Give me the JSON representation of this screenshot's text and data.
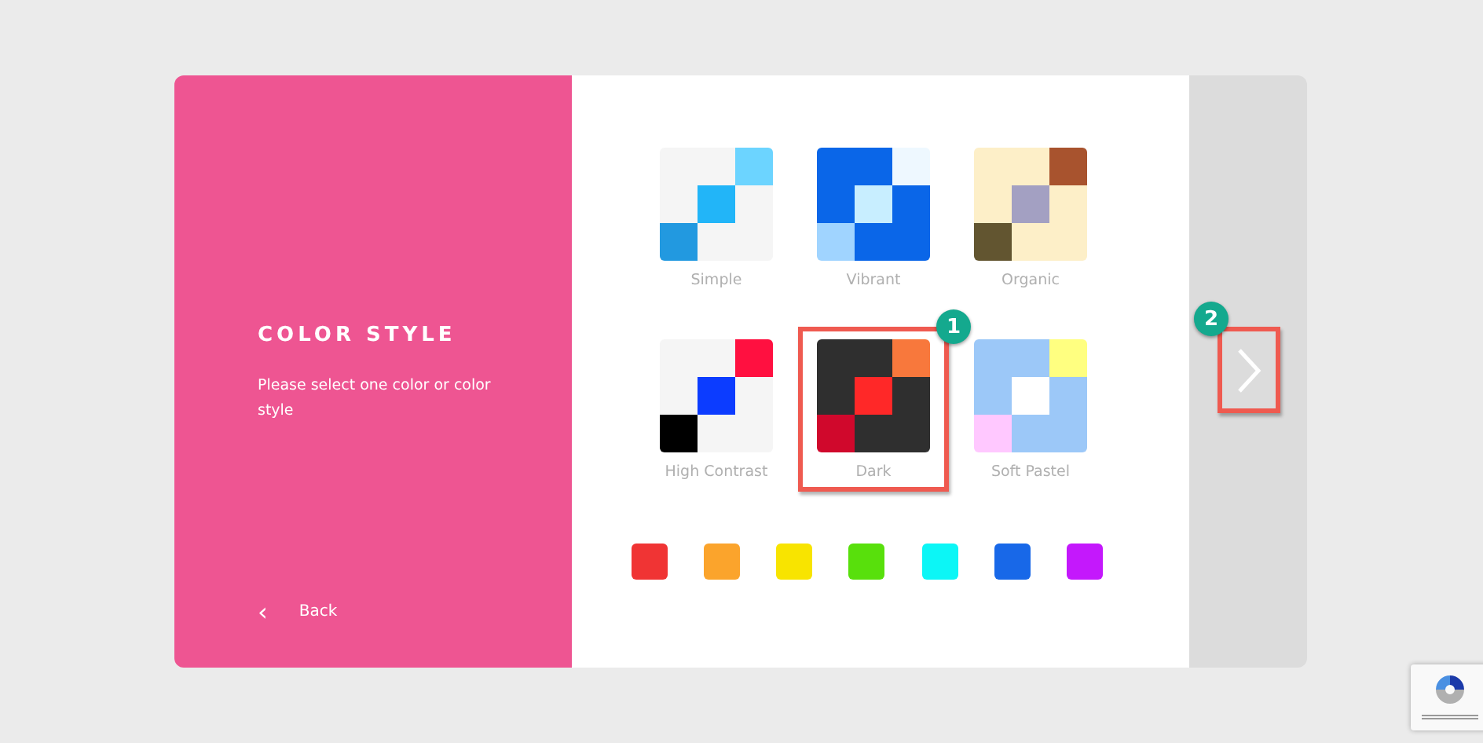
{
  "intro": {
    "title": "COLOR STYLE",
    "description": "Please select one color or color style",
    "back": {
      "icon": "‹",
      "label": "Back"
    }
  },
  "styles": [
    {
      "label": "Simple",
      "selected": false,
      "cells": [
        {
          "color": "#f5f5f5"
        },
        {
          "color": "#6cd4ff"
        },
        {
          "color": "#22b5f8"
        },
        {
          "color": "#2299e0"
        }
      ]
    },
    {
      "label": "Vibrant",
      "selected": false,
      "cells": [
        {
          "color": "#0a66e8"
        },
        {
          "color": "#eef8ff"
        },
        {
          "color": "#c8eeff"
        },
        {
          "color": "#a0d4ff"
        }
      ]
    },
    {
      "label": "Organic",
      "selected": false,
      "cells": [
        {
          "color": "#fdefc8"
        },
        {
          "color": "#a8532e"
        },
        {
          "color": "#a3a0c2"
        },
        {
          "color": "#625530"
        }
      ]
    },
    {
      "label": "High Contrast",
      "selected": false,
      "cells": [
        {
          "color": "#f5f5f5"
        },
        {
          "color": "#ff1040"
        },
        {
          "color": "#0c3cff"
        },
        {
          "color": "#000000"
        }
      ]
    },
    {
      "label": "Dark",
      "selected": true,
      "callout": "1",
      "cells": [
        {
          "color": "#2f2f2f"
        },
        {
          "color": "#f8783c"
        },
        {
          "color": "#ff2828"
        },
        {
          "color": "#d0082c"
        }
      ]
    },
    {
      "label": "Soft Pastel",
      "selected": false,
      "cells": [
        {
          "color": "#9cc8f8"
        },
        {
          "color": "#ffff80"
        },
        {
          "color": "#ffffff"
        },
        {
          "color": "#ffc8ff"
        }
      ]
    }
  ],
  "colors": [
    {
      "color": "#f03434"
    },
    {
      "color": "#fba42c"
    },
    {
      "color": "#f8e400"
    },
    {
      "color": "#58e00c"
    },
    {
      "color": "#0cf6f6"
    },
    {
      "color": "#1868e8"
    },
    {
      "color": "#c418fc"
    }
  ],
  "next": {
    "callout": "2"
  }
}
